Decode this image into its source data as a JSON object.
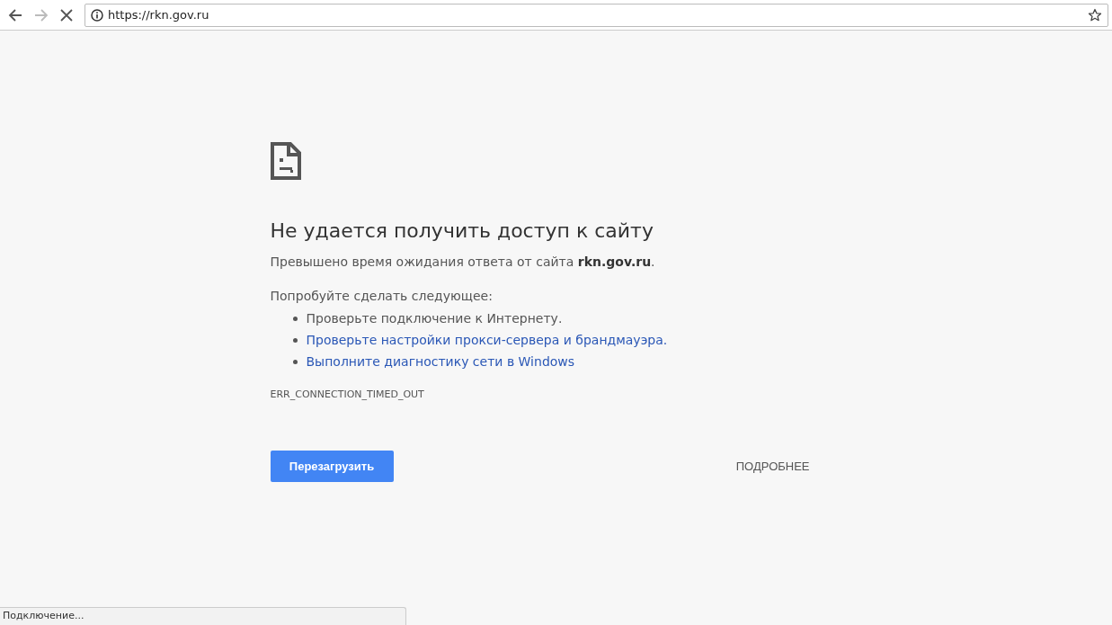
{
  "toolbar": {
    "url": "https://rkn.gov.ru",
    "back_disabled": false,
    "forward_disabled": true
  },
  "error": {
    "title": "Не удается получить доступ к сайту",
    "description": "Превышено время ожидания ответа от сайта **rkn.gov.ru**.",
    "suggestions_heading": "Попробуйте сделать следующее:",
    "suggestions": [
      {
        "kind": "text",
        "text": "Проверьте подключение к Интернету."
      },
      {
        "kind": "link",
        "text": "Проверьте настройки прокси-сервера и брандмауэра."
      },
      {
        "kind": "link",
        "text": "Выполните диагностику сети в Windows"
      }
    ],
    "error_code": "ERR_CONNECTION_TIMED_OUT",
    "reload_button": "Перезагрузить",
    "details_button": "ПОДРОБНЕЕ"
  },
  "status_bar": {
    "text": "Подключение..."
  }
}
